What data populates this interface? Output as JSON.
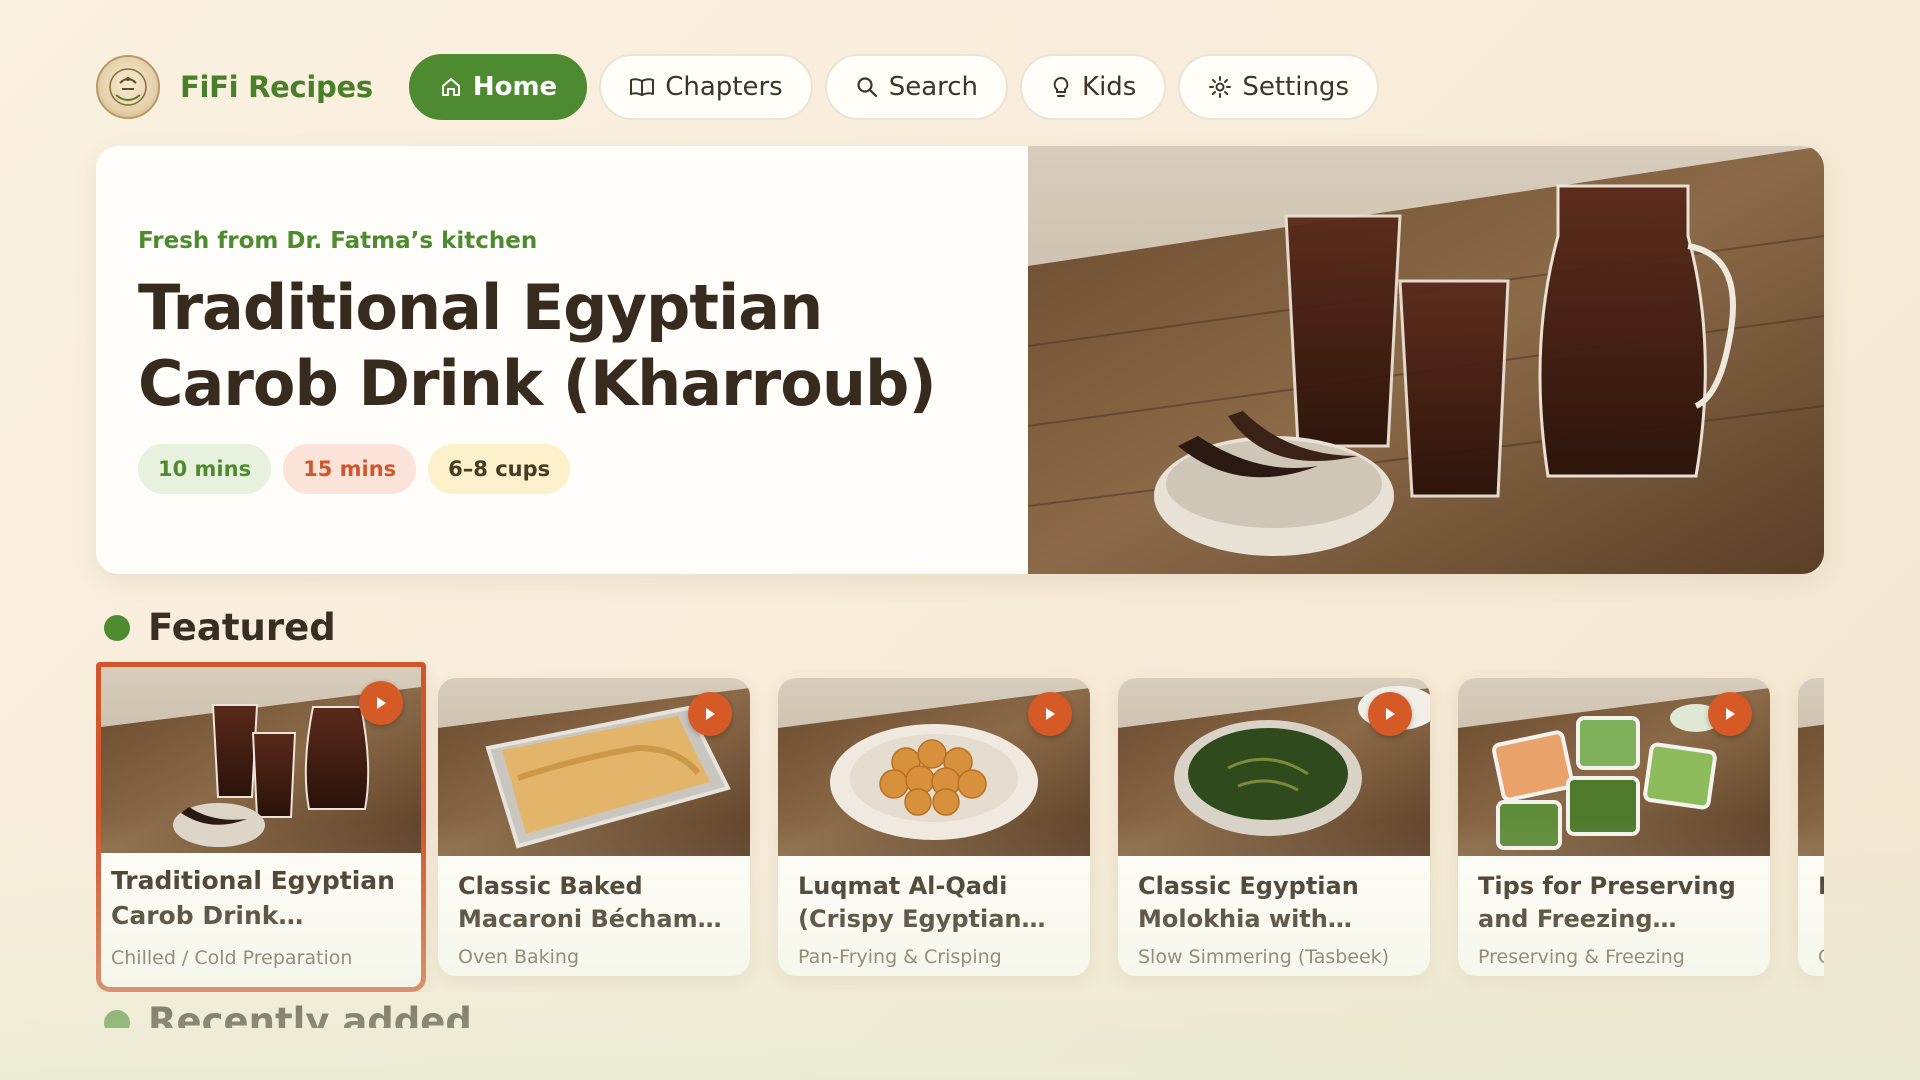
{
  "app": {
    "name": "FiFi Recipes",
    "logo_icon": "crest-logo-icon"
  },
  "nav": [
    {
      "label": "Home",
      "icon": "home-icon",
      "active": true
    },
    {
      "label": "Chapters",
      "icon": "book-icon",
      "active": false
    },
    {
      "label": "Search",
      "icon": "search-icon",
      "active": false
    },
    {
      "label": "Kids",
      "icon": "lightbulb-icon",
      "active": false
    },
    {
      "label": "Settings",
      "icon": "gear-icon",
      "active": false
    }
  ],
  "hero": {
    "kicker": "Fresh from Dr. Fatma’s kitchen",
    "title": "Traditional Egyptian Carob Drink (Kharroub)",
    "chips": {
      "prep": "10 mins",
      "cook": "15 mins",
      "servings": "6–8 cups"
    }
  },
  "sections": {
    "featured": "Featured",
    "recent": "Recently added"
  },
  "featured": [
    {
      "title": "Traditional Egyptian Carob Drink (Kharroub)",
      "subtitle": "Chilled / Cold Preparation",
      "focused": true
    },
    {
      "title": "Classic Baked Macaroni Béchamel (Makarona Béchamel)",
      "subtitle": "Oven Baking",
      "focused": false
    },
    {
      "title": "Luqmat Al-Qadi (Crispy Egyptian Dumplings)",
      "subtitle": "Pan-Frying & Crisping",
      "focused": false
    },
    {
      "title": "Classic Egyptian Molokhia with Garlic-Coriander Tasbeeka",
      "subtitle": "Slow Simmering (Tasbeek)",
      "focused": false
    },
    {
      "title": "Tips for Preserving and Freezing Vegetables",
      "subtitle": "Preserving & Freezing",
      "focused": false
    },
    {
      "title": "E E",
      "subtitle": "C",
      "focused": false
    }
  ],
  "colors": {
    "brand_green": "#4e8b30",
    "accent_orange": "#d65a26",
    "background": "#fbf1e1"
  }
}
